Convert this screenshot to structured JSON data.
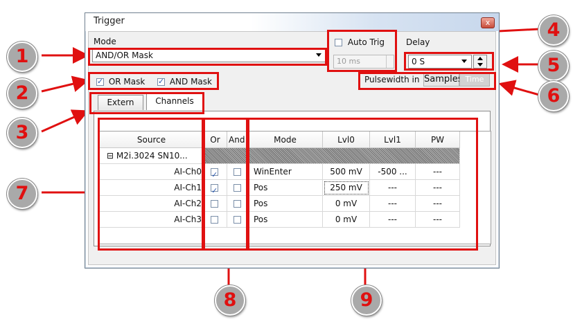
{
  "window": {
    "title": "Trigger",
    "close_glyph": "x"
  },
  "mode": {
    "label": "Mode",
    "value": "AND/OR Mask"
  },
  "auto_trig": {
    "label": "Auto Trig",
    "checked": false,
    "value": "10 ms"
  },
  "delay": {
    "label": "Delay",
    "value": "0 S"
  },
  "masks": {
    "or_label": "OR Mask",
    "or_checked": true,
    "and_label": "AND Mask",
    "and_checked": true
  },
  "pulsewidth": {
    "label": "Pulsewidth in",
    "options": [
      "Samples",
      "Time"
    ],
    "selected": "Samples"
  },
  "tabs": [
    {
      "label": "Extern"
    },
    {
      "label": "Channels",
      "active": true
    }
  ],
  "grid": {
    "columns": [
      "Source",
      "Or",
      "And",
      "Mode",
      "Lvl0",
      "Lvl1",
      "PW"
    ],
    "group": {
      "expander": "⊟",
      "label": "M2i.3024 SN10..."
    },
    "rows": [
      {
        "source": "AI-Ch0",
        "or": true,
        "and": false,
        "mode": "WinEnter",
        "lvl0": "500 mV",
        "lvl1": "-500 ...",
        "pw": "---"
      },
      {
        "source": "AI-Ch1",
        "or": true,
        "and": false,
        "mode": "Pos",
        "lvl0": "250 mV",
        "lvl1": "---",
        "pw": "---"
      },
      {
        "source": "AI-Ch2",
        "or": false,
        "and": false,
        "mode": "Pos",
        "lvl0": "0 mV",
        "lvl1": "---",
        "pw": "---"
      },
      {
        "source": "AI-Ch3",
        "or": false,
        "and": false,
        "mode": "Pos",
        "lvl0": "0 mV",
        "lvl1": "---",
        "pw": "---"
      }
    ]
  },
  "callouts": [
    "1",
    "2",
    "3",
    "4",
    "5",
    "6",
    "7",
    "8",
    "9"
  ],
  "colors": {
    "annotation": "#e01010",
    "callout_bg": "#a9a9a9"
  }
}
